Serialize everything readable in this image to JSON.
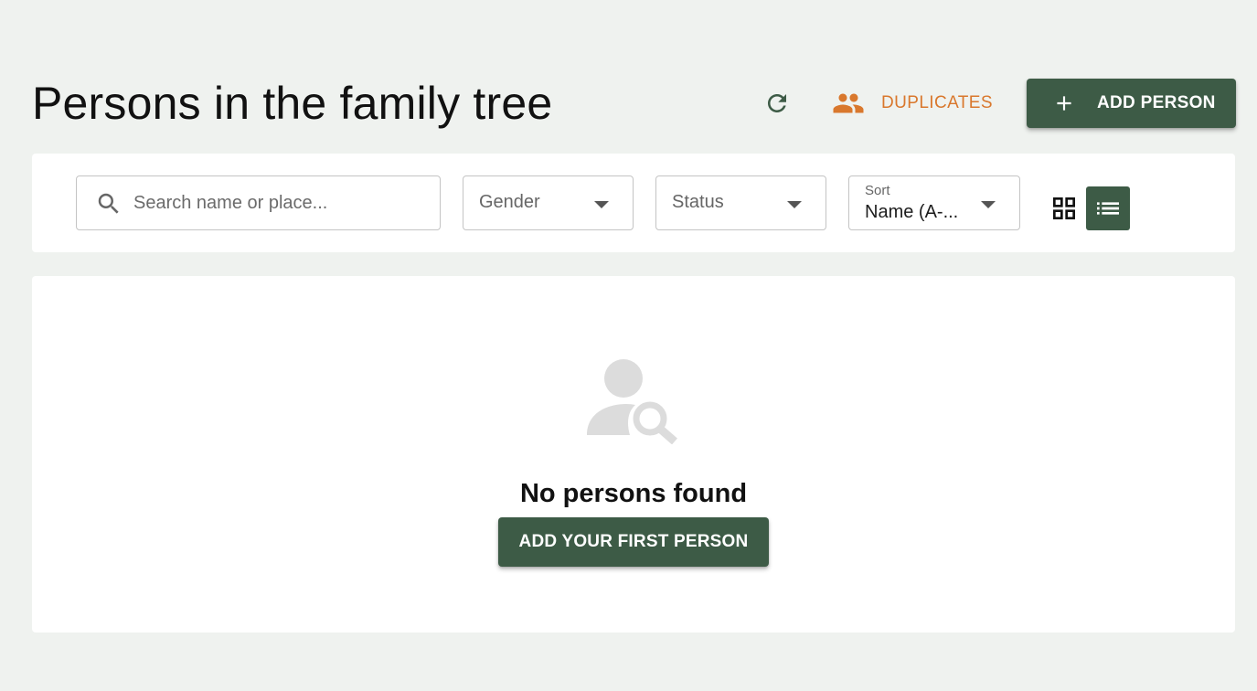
{
  "header": {
    "title": "Persons in the family tree",
    "refresh_icon": "refresh-icon",
    "duplicates_label": "DUPLICATES",
    "duplicates_icon": "people-icon",
    "add_person_label": "ADD PERSON",
    "add_icon": "plus-icon"
  },
  "filters": {
    "search": {
      "placeholder": "Search name or place...",
      "value": ""
    },
    "gender": {
      "label": "Gender"
    },
    "status": {
      "label": "Status"
    },
    "sort": {
      "label": "Sort",
      "value": "Name (A-..."
    },
    "view_mode": {
      "options": [
        "grid",
        "list"
      ],
      "selected": "list"
    }
  },
  "empty_state": {
    "icon": "person-search-icon",
    "message": "No persons found",
    "button_label": "ADD YOUR FIRST PERSON"
  },
  "colors": {
    "background": "#eff2ef",
    "primary": "#3d5b46",
    "accent": "#d9782d",
    "card": "#ffffff"
  }
}
